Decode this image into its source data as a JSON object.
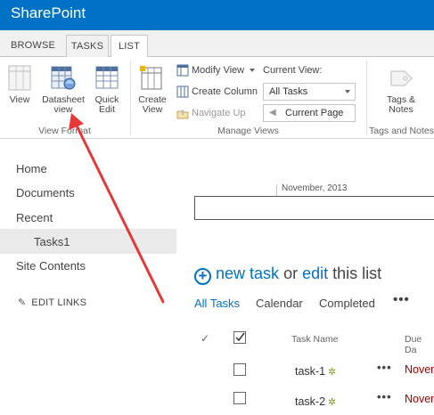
{
  "suite": {
    "brand": "SharePoint"
  },
  "ribbon": {
    "tabs": [
      {
        "label": "BROWSE"
      },
      {
        "label": "TASKS"
      },
      {
        "label": "LIST"
      }
    ],
    "view_format": {
      "view_label": "View",
      "datasheet_label_line1": "Datasheet",
      "datasheet_label_line2": "view",
      "quick_edit_line1": "Quick",
      "quick_edit_line2": "Edit",
      "group_label": "View Format"
    },
    "manage_views": {
      "create_view_line1": "Create",
      "create_view_line2": "View",
      "modify_view_label": "Modify View",
      "create_column_label": "Create Column",
      "navigate_up_label": "Navigate Up",
      "current_view_label": "Current View:",
      "current_view_value": "All Tasks",
      "current_page_label": "Current Page",
      "group_label": "Manage Views"
    },
    "tags_notes": {
      "button_line1": "Tags &",
      "button_line2": "Notes",
      "group_label": "Tags and Notes"
    }
  },
  "nav": {
    "items": [
      {
        "label": "Home"
      },
      {
        "label": "Documents"
      },
      {
        "label": "Recent"
      },
      {
        "label": "Tasks1"
      },
      {
        "label": "Site Contents"
      }
    ],
    "edit_links": "EDIT LINKS"
  },
  "timeline": {
    "date_label": "November, 2013"
  },
  "list": {
    "new_task": "new task",
    "or": "or",
    "edit": "edit",
    "this_list": "this list",
    "views": [
      {
        "label": "All Tasks"
      },
      {
        "label": "Calendar"
      },
      {
        "label": "Completed"
      }
    ],
    "more_views": "•••",
    "columns": {
      "title": "Task Name",
      "due": "Due Da"
    },
    "rows": [
      {
        "title": "task-1",
        "due": "Novem"
      },
      {
        "title": "task-2",
        "due": "Novem"
      }
    ],
    "row_menu": "•••"
  },
  "colors": {
    "suite": "#0072c6",
    "link": "#0072c6",
    "due": "#a80000",
    "arrow": "#e53935"
  }
}
